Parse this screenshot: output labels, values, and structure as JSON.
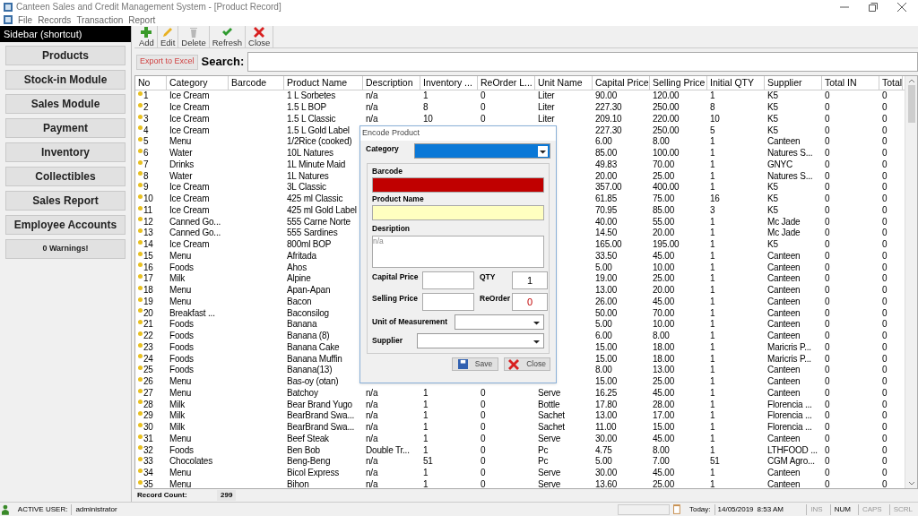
{
  "window": {
    "title": "Canteen Sales and Credit Management System - [Product Record]"
  },
  "menu": [
    "File",
    "Records",
    "Transaction",
    "Report"
  ],
  "sidebar": {
    "title": "Sidebar (shortcut)",
    "items": [
      "Products",
      "Stock-in Module",
      "Sales Module",
      "Payment",
      "Inventory",
      "Collectibles",
      "Sales Report",
      "Employee Accounts"
    ],
    "warning": "0 Warnings!"
  },
  "toolbar": [
    {
      "label": "Add",
      "kind": "add"
    },
    {
      "label": "Edit",
      "kind": "edit"
    },
    {
      "label": "Delete",
      "kind": "delete"
    },
    {
      "label": "Refresh",
      "kind": "refresh"
    },
    {
      "label": "Close",
      "kind": "close"
    }
  ],
  "export_button": "Export to Excel",
  "search": {
    "label": "Search:"
  },
  "table": {
    "columns": [
      "No",
      "Category",
      "Barcode",
      "Product Name",
      "Description",
      "Inventory ...",
      "ReOrder L...",
      "Unit Name",
      "Capital Price",
      "Selling Price",
      "Initial QTY",
      "Supplier",
      "Total IN",
      "Total"
    ],
    "rows": [
      [
        "1",
        "Ice Cream",
        null,
        "1 L Sorbetes",
        "n/a",
        "1",
        "0",
        "Liter",
        "90.00",
        "120.00",
        "1",
        "K5",
        "0",
        "0"
      ],
      [
        "2",
        "Ice Cream",
        null,
        "1.5 L BOP",
        "n/a",
        "8",
        "0",
        "Liter",
        "227.30",
        "250.00",
        "8",
        "K5",
        "0",
        "0"
      ],
      [
        "3",
        "Ice Cream",
        null,
        "1.5 L Classic",
        "n/a",
        "10",
        "0",
        "Liter",
        "209.10",
        "220.00",
        "10",
        "K5",
        "0",
        "0"
      ],
      [
        "4",
        "Ice Cream",
        null,
        "1.5 L Gold Label",
        null,
        null,
        null,
        null,
        "227.30",
        "250.00",
        "5",
        "K5",
        "0",
        "0"
      ],
      [
        "5",
        "Menu",
        null,
        "1/2Rice (cooked)",
        null,
        null,
        null,
        null,
        "6.00",
        "8.00",
        "1",
        "Canteen",
        "0",
        "0"
      ],
      [
        "6",
        "Water",
        null,
        "10L Natures",
        null,
        null,
        null,
        null,
        "85.00",
        "100.00",
        "1",
        "Natures S...",
        "0",
        "0"
      ],
      [
        "7",
        "Drinks",
        null,
        "1L Minute Maid",
        null,
        null,
        null,
        null,
        "49.83",
        "70.00",
        "1",
        "GNYC",
        "0",
        "0"
      ],
      [
        "8",
        "Water",
        null,
        "1L Natures",
        null,
        null,
        null,
        null,
        "20.00",
        "25.00",
        "1",
        "Natures S...",
        "0",
        "0"
      ],
      [
        "9",
        "Ice Cream",
        null,
        "3L Classic",
        null,
        null,
        null,
        null,
        "357.00",
        "400.00",
        "1",
        "K5",
        "0",
        "0"
      ],
      [
        "10",
        "Ice Cream",
        null,
        "425 ml Classic",
        null,
        null,
        null,
        null,
        "61.85",
        "75.00",
        "16",
        "K5",
        "0",
        "0"
      ],
      [
        "11",
        "Ice Cream",
        null,
        "425 ml Gold Label",
        null,
        null,
        null,
        null,
        "70.95",
        "85.00",
        "3",
        "K5",
        "0",
        "0"
      ],
      [
        "12",
        "Canned Go...",
        null,
        "555 Carne Norte",
        null,
        null,
        null,
        null,
        "40.00",
        "55.00",
        "1",
        "Mc Jade",
        "0",
        "0"
      ],
      [
        "13",
        "Canned Go...",
        null,
        "555 Sardines",
        null,
        null,
        null,
        null,
        "14.50",
        "20.00",
        "1",
        "Mc Jade",
        "0",
        "0"
      ],
      [
        "14",
        "Ice Cream",
        null,
        "800ml BOP",
        null,
        null,
        null,
        null,
        "165.00",
        "195.00",
        "1",
        "K5",
        "0",
        "0"
      ],
      [
        "15",
        "Menu",
        null,
        "Afritada",
        null,
        null,
        null,
        null,
        "33.50",
        "45.00",
        "1",
        "Canteen",
        "0",
        "0"
      ],
      [
        "16",
        "Foods",
        null,
        "Ahos",
        null,
        null,
        null,
        null,
        "5.00",
        "10.00",
        "1",
        "Canteen",
        "0",
        "0"
      ],
      [
        "17",
        "Milk",
        null,
        "Alpine",
        null,
        null,
        null,
        null,
        "19.00",
        "25.00",
        "1",
        "Canteen",
        "0",
        "0"
      ],
      [
        "18",
        "Menu",
        null,
        "Apan-Apan",
        null,
        null,
        null,
        null,
        "13.00",
        "20.00",
        "1",
        "Canteen",
        "0",
        "0"
      ],
      [
        "19",
        "Menu",
        null,
        "Bacon",
        null,
        null,
        null,
        null,
        "26.00",
        "45.00",
        "1",
        "Canteen",
        "0",
        "0"
      ],
      [
        "20",
        "Breakfast ...",
        null,
        "Baconsilog",
        null,
        null,
        null,
        null,
        "50.00",
        "70.00",
        "1",
        "Canteen",
        "0",
        "0"
      ],
      [
        "21",
        "Foods",
        null,
        "Banana",
        null,
        null,
        null,
        null,
        "5.00",
        "10.00",
        "1",
        "Canteen",
        "0",
        "0"
      ],
      [
        "22",
        "Foods",
        null,
        "Banana (8)",
        null,
        null,
        null,
        null,
        "6.00",
        "8.00",
        "1",
        "Canteen",
        "0",
        "0"
      ],
      [
        "23",
        "Foods",
        null,
        "Banana Cake",
        null,
        null,
        null,
        null,
        "15.00",
        "18.00",
        "1",
        "Maricris P...",
        "0",
        "0"
      ],
      [
        "24",
        "Foods",
        null,
        "Banana Muffin",
        null,
        null,
        null,
        null,
        "15.00",
        "18.00",
        "1",
        "Maricris P...",
        "0",
        "0"
      ],
      [
        "25",
        "Foods",
        null,
        "Banana(13)",
        null,
        null,
        null,
        null,
        "8.00",
        "13.00",
        "1",
        "Canteen",
        "0",
        "0"
      ],
      [
        "26",
        "Menu",
        null,
        "Bas-oy (otan)",
        null,
        null,
        null,
        null,
        "15.00",
        "25.00",
        "1",
        "Canteen",
        "0",
        "0"
      ],
      [
        "27",
        "Menu",
        null,
        "Batchoy",
        "n/a",
        "1",
        "0",
        "Serve",
        "16.25",
        "45.00",
        "1",
        "Canteen",
        "0",
        "0"
      ],
      [
        "28",
        "Milk",
        null,
        "Bear Brand Yugo",
        "n/a",
        "1",
        "0",
        "Bottle",
        "17.80",
        "28.00",
        "1",
        "Florencia ...",
        "0",
        "0"
      ],
      [
        "29",
        "Milk",
        null,
        "BearBrand Swa...",
        "n/a",
        "1",
        "0",
        "Sachet",
        "13.00",
        "17.00",
        "1",
        "Florencia ...",
        "0",
        "0"
      ],
      [
        "30",
        "Milk",
        null,
        "BearBrand Swa...",
        "n/a",
        "1",
        "0",
        "Sachet",
        "11.00",
        "15.00",
        "1",
        "Florencia ...",
        "0",
        "0"
      ],
      [
        "31",
        "Menu",
        null,
        "Beef Steak",
        "n/a",
        "1",
        "0",
        "Serve",
        "30.00",
        "45.00",
        "1",
        "Canteen",
        "0",
        "0"
      ],
      [
        "32",
        "Foods",
        null,
        "Ben Bob",
        "Double Tr...",
        "1",
        "0",
        "Pc",
        "4.75",
        "8.00",
        "1",
        "LTHFOOD ...",
        "0",
        "0"
      ],
      [
        "33",
        "Chocolates",
        null,
        "Beng-Beng",
        "n/a",
        "51",
        "0",
        "Pc",
        "5.00",
        "7.00",
        "51",
        "CGM Agro...",
        "0",
        "0"
      ],
      [
        "34",
        "Menu",
        null,
        "Bicol Express",
        "n/a",
        "1",
        "0",
        "Serve",
        "30.00",
        "45.00",
        "1",
        "Canteen",
        "0",
        "0"
      ],
      [
        "35",
        "Menu",
        null,
        "Bihon",
        "n/a",
        "1",
        "0",
        "Serve",
        "13.60",
        "25.00",
        "1",
        "Canteen",
        "0",
        "0"
      ]
    ]
  },
  "record_count": {
    "label": "Record Count:",
    "value": "299"
  },
  "dialog": {
    "title": "Encode Product",
    "category": {
      "label": "Category",
      "selected": true
    },
    "fields": [
      {
        "label": "Barcode",
        "color": "#c00000"
      },
      {
        "label": "Product Name",
        "color": "#ffffc0"
      }
    ],
    "description": {
      "label": "Desription",
      "placeholder": "n/a"
    },
    "capital_price": {
      "label": "Capital Price"
    },
    "qty": {
      "label": "QTY",
      "value": "1"
    },
    "selling_price": {
      "label": "Selling Price"
    },
    "reorder": {
      "label": "ReOrder",
      "value": "0"
    },
    "unit": {
      "label": "Unit of Measurement"
    },
    "supplier": {
      "label": "Supplier"
    },
    "buttons": [
      {
        "label": "Save",
        "kind": "save"
      },
      {
        "label": "Close",
        "kind": "close"
      }
    ]
  },
  "status_bar": {
    "user_label": "ACTIVE USER:",
    "user": "administrator",
    "today_label": "Today:",
    "date": "14/05/2019",
    "time": "8:53 AM",
    "indicators": [
      {
        "label": "INS",
        "on": false
      },
      {
        "label": "NUM",
        "on": true
      },
      {
        "label": "CAPS",
        "on": false
      },
      {
        "label": "SCRL",
        "on": false
      }
    ]
  }
}
